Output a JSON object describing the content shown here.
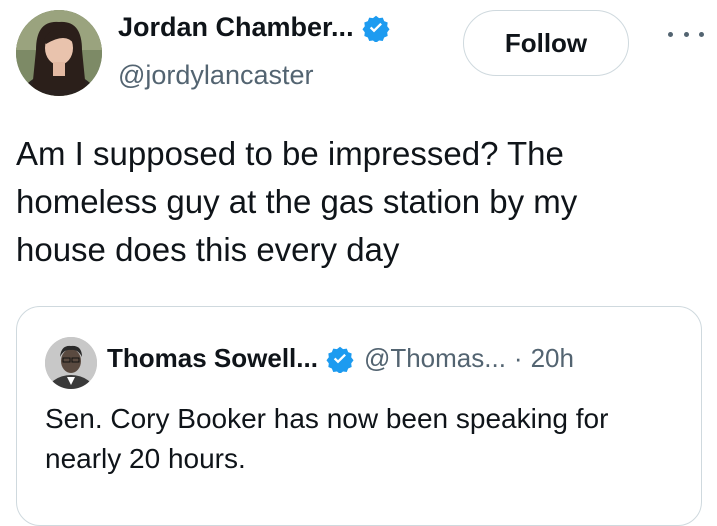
{
  "tweet": {
    "author_name": "Jordan Chamber...",
    "author_handle": "@jordylancaster",
    "follow_label": "Follow",
    "text": "Am I supposed to be impressed? The homeless guy at the gas station by my house does this every day",
    "icons": {
      "verified": "verified-badge-icon",
      "more": "more-icon"
    },
    "colors": {
      "verified": "#1d9bf0",
      "secondary_text": "#536471",
      "border": "#cfd9de"
    }
  },
  "quoted_tweet": {
    "author_name": "Thomas Sowell...",
    "author_handle": "@Thomas...",
    "separator": "·",
    "time": "20h",
    "text": "Sen. Cory Booker has now been speaking for nearly 20 hours."
  }
}
